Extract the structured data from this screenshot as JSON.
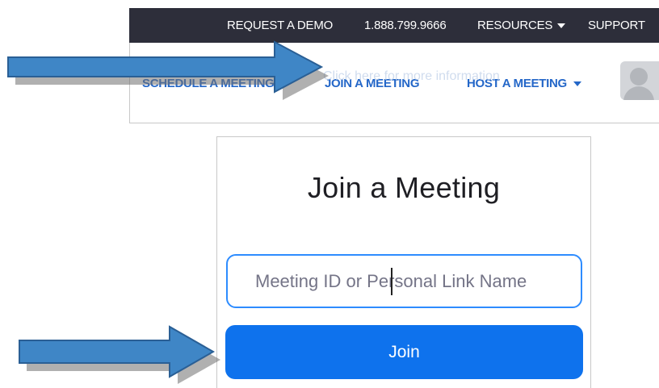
{
  "topbar": {
    "request_demo": "REQUEST A DEMO",
    "phone": "1.888.799.9666",
    "resources": "RESOURCES",
    "support": "SUPPORT"
  },
  "nav": {
    "schedule": "SCHEDULE A MEETING",
    "join": "JOIN A MEETING",
    "host": "HOST A MEETING",
    "hint": "Click here for more information"
  },
  "card": {
    "title": "Join a Meeting",
    "input_placeholder": "Meeting ID or Personal Link Name",
    "join_label": "Join"
  },
  "colors": {
    "topbar_bg": "#2d2e3a",
    "nav_link": "#2467c8",
    "input_border": "#2d8cff",
    "join_button": "#0e72ed",
    "arrow": "#3f86c6"
  },
  "icons": [
    "caret-down-icon",
    "avatar-icon",
    "annotation-arrow-icon"
  ]
}
